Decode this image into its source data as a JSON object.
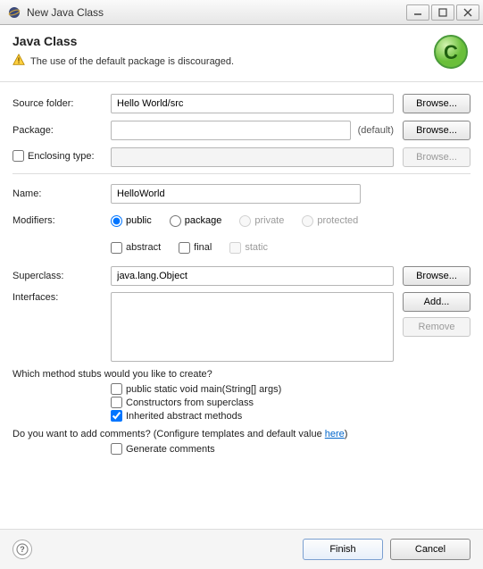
{
  "title": "New Java Class",
  "header": {
    "heading": "Java Class",
    "hint": "The use of the default package is discouraged."
  },
  "labels": {
    "sourceFolder": "Source folder:",
    "package": "Package:",
    "enclosingType": "Enclosing type:",
    "name": "Name:",
    "modifiers": "Modifiers:",
    "superclass": "Superclass:",
    "interfaces": "Interfaces:"
  },
  "values": {
    "sourceFolder": "Hello World/src",
    "package": "",
    "packageDefault": "(default)",
    "enclosingType": "",
    "name": "HelloWorld",
    "superclass": "java.lang.Object"
  },
  "modifiers": {
    "public": "public",
    "package": "package",
    "private": "private",
    "protected": "protected",
    "abstract": "abstract",
    "final": "final",
    "static": "static"
  },
  "buttons": {
    "browse": "Browse...",
    "add": "Add...",
    "remove": "Remove",
    "finish": "Finish",
    "cancel": "Cancel"
  },
  "stubs": {
    "question": "Which method stubs would you like to create?",
    "main": "public static void main(String[] args)",
    "constructors": "Constructors from superclass",
    "inherited": "Inherited abstract methods"
  },
  "comments": {
    "questionPre": "Do you want to add comments? (Configure templates and default value ",
    "link": "here",
    "questionPost": ")",
    "generate": "Generate comments"
  }
}
